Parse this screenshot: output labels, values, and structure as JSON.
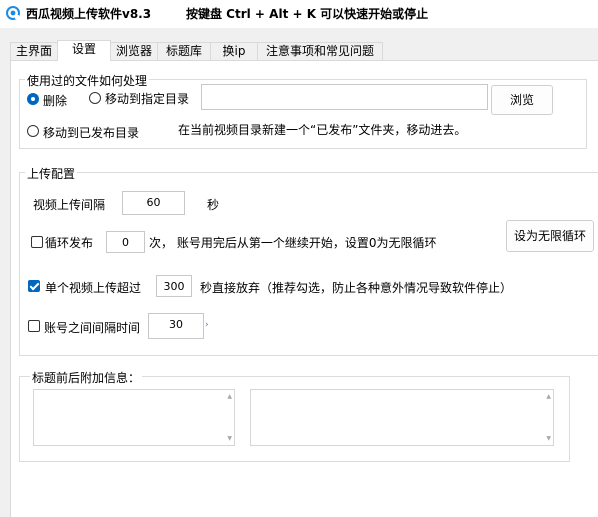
{
  "app": {
    "title": "西瓜视频上传软件v8.3",
    "hotkey_tip": "按键盘 Ctrl + Alt + K  可以快速开始或停止",
    "accent_color": "#0067c0",
    "icon": "app-logo-icon"
  },
  "tabs": [
    {
      "label": "主界面",
      "active": false
    },
    {
      "label": "设置",
      "active": true
    },
    {
      "label": "浏览器",
      "active": false
    },
    {
      "label": "标题库",
      "active": false
    },
    {
      "label": "换ip",
      "active": false
    },
    {
      "label": "注意事项和常见问题",
      "active": false
    }
  ],
  "file_handling": {
    "group_title": "使用过的文件如何处理",
    "option_delete": "删除",
    "option_move_to_dir": "移动到指定目录",
    "option_move_published": "移动到已发布目录",
    "selected": "删除",
    "dir_path_value": "",
    "browse_label": "浏览",
    "published_note": "在当前视频目录新建一个“已发布”文件夹，移动进去。"
  },
  "upload_config": {
    "group_title": "上传配置",
    "interval_label": "视频上传间隔",
    "interval_value": "60",
    "interval_unit": "秒",
    "loop_label": "循环发布",
    "loop_checked": false,
    "loop_value": "0",
    "loop_suffix": "次，  账号用完后从第一个继续开始，设置0为无限循环",
    "set_infinite_label": "设为无限循环",
    "timeout_label": "单个视频上传超过",
    "timeout_checked": true,
    "timeout_value": "300",
    "timeout_suffix": "秒直接放弃（推荐勾选，防止各种意外情况导致软件停止）",
    "account_interval_label": "账号之间间隔时间",
    "account_interval_checked": false,
    "account_interval_value": "30"
  },
  "title_affix": {
    "group_title": "标题前后附加信息：",
    "prefix_value": "",
    "suffix_value": ""
  }
}
